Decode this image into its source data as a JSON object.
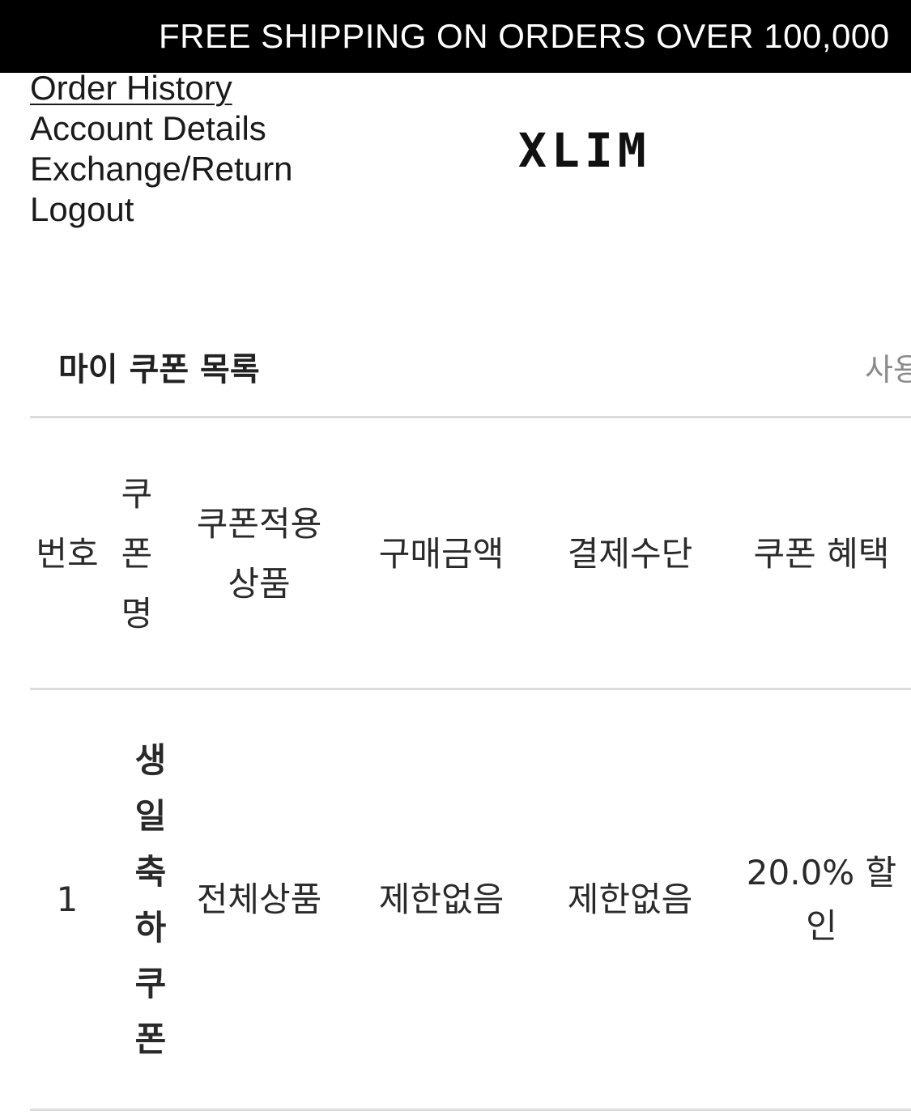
{
  "banner": {
    "text": "FREE SHIPPING ON ORDERS OVER 100,000"
  },
  "account_menu": {
    "order_history": "Order History",
    "account_details": "Account Details",
    "exchange_return": "Exchange/Return",
    "logout": "Logout"
  },
  "brand": {
    "logo": "XLIM"
  },
  "coupons": {
    "title": "마이 쿠폰 목록",
    "right_link": "사용",
    "columns": {
      "number": "번호",
      "coupon_name": "쿠폰명",
      "applicable_products": "쿠폰적용상품",
      "purchase_amount": "구매금액",
      "payment_method": "결제수단",
      "benefit": "쿠폰 혜택"
    },
    "rows": [
      {
        "number": "1",
        "coupon_name": "생일축하쿠폰",
        "applicable_products": "전체상품",
        "purchase_amount": "제한없음",
        "payment_method": "제한없음",
        "benefit": "20.0% 할인"
      }
    ]
  }
}
